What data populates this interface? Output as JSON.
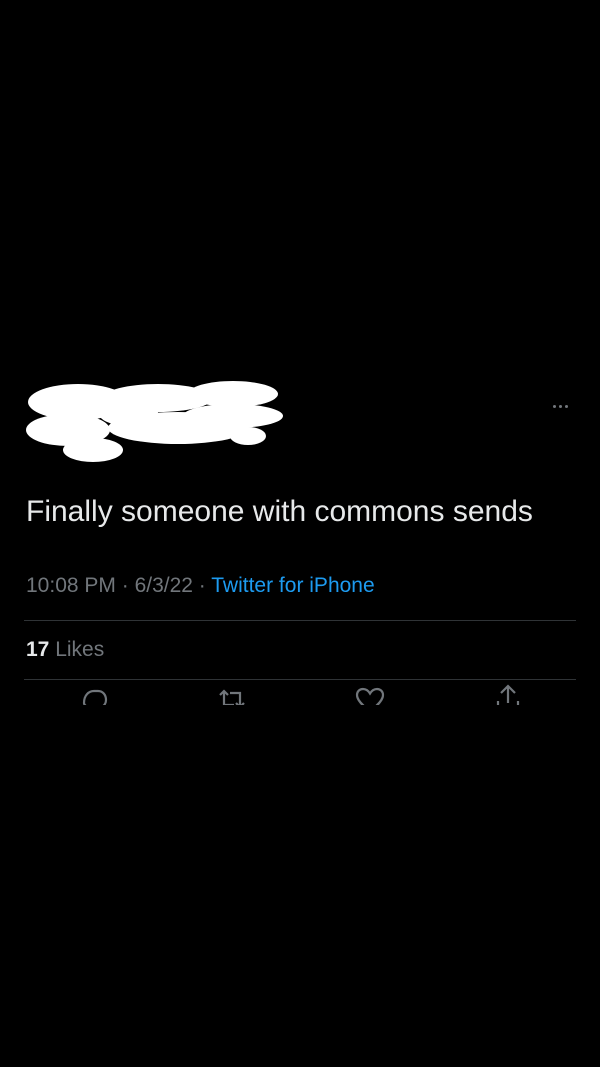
{
  "tweet": {
    "text": "Finally someone with commons sends",
    "time": "10:08 PM",
    "date": "6/3/22",
    "separator": "·",
    "source": "Twitter for iPhone",
    "likes_count": "17",
    "likes_label": "Likes"
  },
  "icons": {
    "more": "more-horizontal-icon",
    "reply": "reply-icon",
    "retweet": "retweet-icon",
    "like": "heart-icon",
    "share": "share-icon"
  },
  "colors": {
    "background": "#000000",
    "primary_text": "#e7e9ea",
    "secondary_text": "#71767b",
    "link": "#1d9bf0",
    "divider": "#2f3336",
    "redaction": "#ffffff"
  }
}
